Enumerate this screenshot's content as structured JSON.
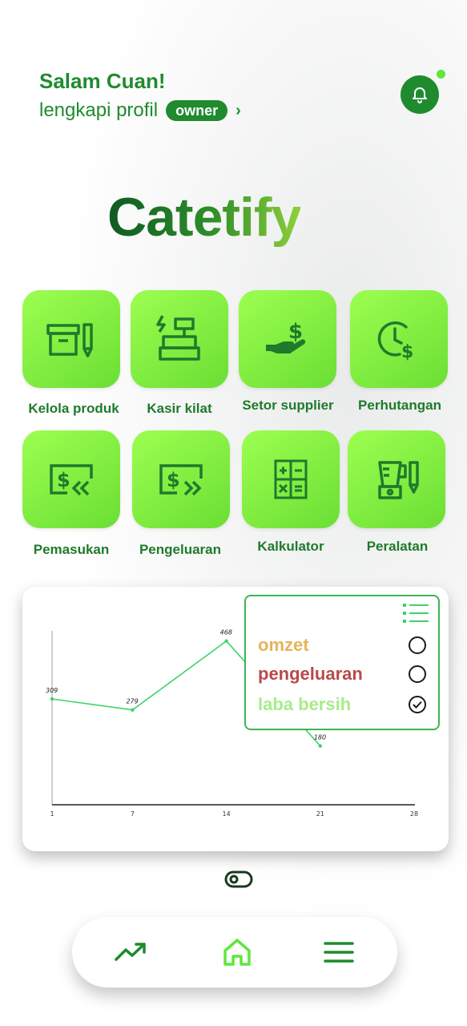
{
  "header": {
    "greeting": "Salam Cuan!",
    "subtitle": "lengkapi profil",
    "badge": "owner",
    "chevron": "›"
  },
  "logo": {
    "text": "Catetify"
  },
  "menu": [
    {
      "label": "Kelola produk",
      "icon": "box-pencil-icon"
    },
    {
      "label": "Kasir kilat",
      "icon": "cash-register-icon"
    },
    {
      "label": "Setor supplier",
      "icon": "hand-money-icon"
    },
    {
      "label": "Perhutangan",
      "icon": "clock-dollar-icon"
    },
    {
      "label": "Pemasukan",
      "icon": "money-in-icon"
    },
    {
      "label": "Pengeluaran",
      "icon": "money-out-icon"
    },
    {
      "label": "Kalkulator",
      "icon": "calculator-icon"
    },
    {
      "label": "Peralatan",
      "icon": "blender-icon"
    }
  ],
  "legend": [
    {
      "label": "omzet",
      "color": "#e5b45a",
      "checked": false
    },
    {
      "label": "pengeluaran",
      "color": "#b84a4a",
      "checked": false
    },
    {
      "label": "laba bersih",
      "color": "#a8ec8a",
      "checked": true
    }
  ],
  "chart_data": {
    "type": "line",
    "x": [
      1,
      7,
      14,
      21
    ],
    "values": [
      309,
      279,
      468,
      180
    ],
    "x_ticks": [
      "1",
      "7",
      "14",
      "21",
      "28"
    ],
    "xlim": [
      1,
      28
    ],
    "color": "#3cd46a"
  },
  "colors": {
    "primary": "#1f8b2e",
    "tile": "#7aec3c"
  }
}
